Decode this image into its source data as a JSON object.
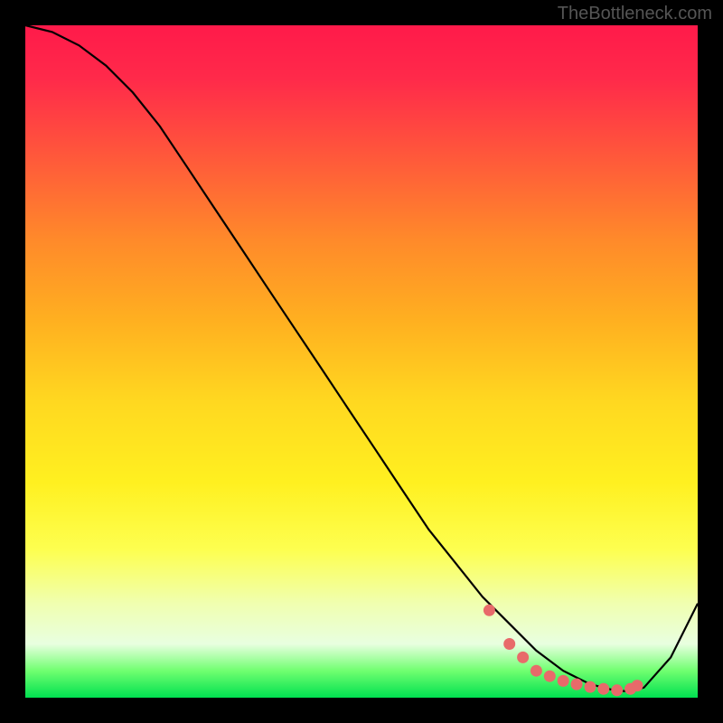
{
  "watermark": "TheBottleneck.com",
  "chart_data": {
    "type": "line",
    "title": "",
    "xlabel": "",
    "ylabel": "",
    "xlim": [
      0,
      100
    ],
    "ylim": [
      0,
      100
    ],
    "series": [
      {
        "name": "curve",
        "x": [
          0,
          4,
          8,
          12,
          16,
          20,
          24,
          28,
          32,
          36,
          40,
          44,
          48,
          52,
          56,
          60,
          64,
          68,
          72,
          76,
          80,
          82,
          84,
          86,
          88,
          90,
          92,
          96,
          100
        ],
        "values": [
          100,
          99,
          97,
          94,
          90,
          85,
          79,
          73,
          67,
          61,
          55,
          49,
          43,
          37,
          31,
          25,
          20,
          15,
          11,
          7,
          4,
          3,
          2,
          1.5,
          1,
          1,
          1.5,
          6,
          14
        ]
      }
    ],
    "markers": {
      "name": "highlight-points",
      "color": "#e86a6a",
      "x": [
        69,
        72,
        74,
        76,
        78,
        80,
        82,
        84,
        86,
        88,
        90,
        91
      ],
      "values": [
        13,
        8,
        6,
        4,
        3.2,
        2.5,
        2,
        1.6,
        1.3,
        1.1,
        1.3,
        1.8
      ]
    }
  }
}
